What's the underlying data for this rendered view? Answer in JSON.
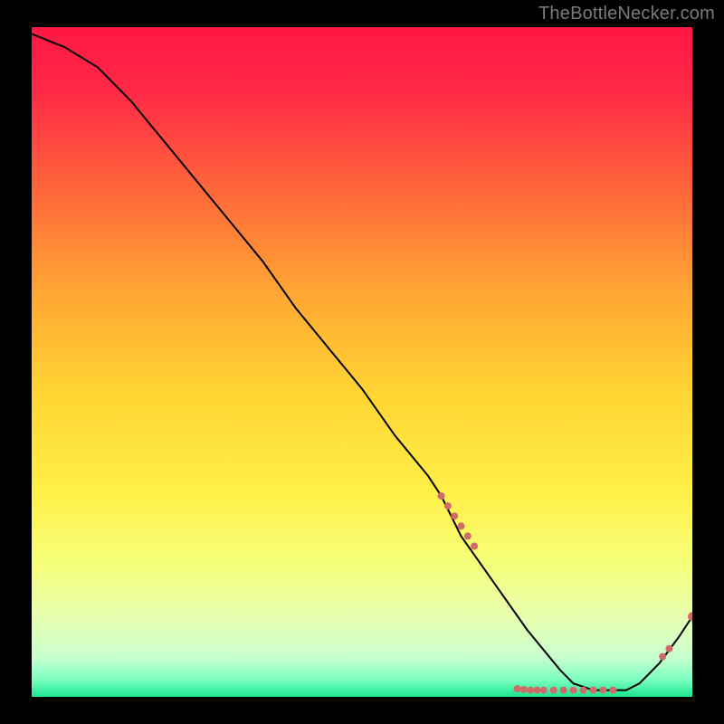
{
  "attribution": "TheBottleNecker.com",
  "colors": {
    "bg": "#000000",
    "attribution_text": "#7a7a7a",
    "line": "#000000",
    "marker": "#cf6b68",
    "gradient_stops": [
      {
        "offset": 0.0,
        "color": "#ff1744"
      },
      {
        "offset": 0.1,
        "color": "#ff2a46"
      },
      {
        "offset": 0.25,
        "color": "#ff6a3a"
      },
      {
        "offset": 0.4,
        "color": "#ffa733"
      },
      {
        "offset": 0.55,
        "color": "#ffd633"
      },
      {
        "offset": 0.7,
        "color": "#fff04a"
      },
      {
        "offset": 0.8,
        "color": "#f6ff7a"
      },
      {
        "offset": 0.88,
        "color": "#e8ffb0"
      },
      {
        "offset": 0.94,
        "color": "#c9ffce"
      },
      {
        "offset": 0.975,
        "color": "#7affc0"
      },
      {
        "offset": 1.0,
        "color": "#18e68f"
      }
    ]
  },
  "chart_data": {
    "type": "line",
    "title": "",
    "xlabel": "",
    "ylabel": "",
    "xlim": [
      0,
      100
    ],
    "ylim": [
      0,
      100
    ],
    "series": [
      {
        "name": "curve",
        "x": [
          0,
          5,
          10,
          15,
          20,
          25,
          30,
          35,
          40,
          45,
          50,
          55,
          60,
          62,
          65,
          70,
          75,
          80,
          82,
          85,
          88,
          90,
          92,
          95,
          98,
          100
        ],
        "y": [
          99,
          97,
          94,
          89,
          83,
          77,
          71,
          65,
          58,
          52,
          46,
          39,
          33,
          30,
          24,
          17,
          10,
          4,
          2,
          1,
          1,
          1,
          2,
          5,
          9,
          12
        ]
      }
    ],
    "markers": [
      {
        "x": 62.0,
        "y": 30.0,
        "r": 4
      },
      {
        "x": 63.0,
        "y": 28.5,
        "r": 4
      },
      {
        "x": 64.0,
        "y": 27.0,
        "r": 4
      },
      {
        "x": 65.0,
        "y": 25.5,
        "r": 4
      },
      {
        "x": 66.0,
        "y": 24.0,
        "r": 4
      },
      {
        "x": 67.0,
        "y": 22.5,
        "r": 4
      },
      {
        "x": 73.5,
        "y": 1.2,
        "r": 4
      },
      {
        "x": 74.5,
        "y": 1.1,
        "r": 4
      },
      {
        "x": 75.5,
        "y": 1.0,
        "r": 4
      },
      {
        "x": 76.5,
        "y": 1.0,
        "r": 4
      },
      {
        "x": 77.5,
        "y": 1.0,
        "r": 4
      },
      {
        "x": 79.0,
        "y": 1.0,
        "r": 4
      },
      {
        "x": 80.5,
        "y": 1.0,
        "r": 4
      },
      {
        "x": 82.0,
        "y": 1.0,
        "r": 4
      },
      {
        "x": 83.5,
        "y": 1.0,
        "r": 4
      },
      {
        "x": 85.0,
        "y": 1.0,
        "r": 4
      },
      {
        "x": 86.5,
        "y": 1.0,
        "r": 4
      },
      {
        "x": 88.0,
        "y": 1.0,
        "r": 4
      },
      {
        "x": 95.5,
        "y": 6.0,
        "r": 4
      },
      {
        "x": 96.5,
        "y": 7.2,
        "r": 4
      },
      {
        "x": 100.0,
        "y": 12.0,
        "r": 5
      }
    ]
  }
}
